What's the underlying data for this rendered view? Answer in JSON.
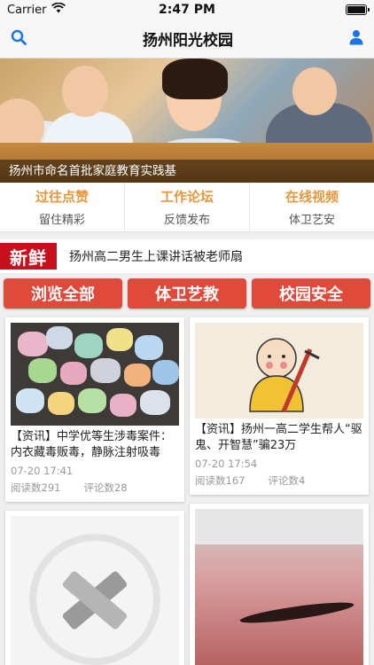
{
  "status_bar": {
    "carrier": "Carrier",
    "time": "2:47 PM",
    "battery_level": 1.0
  },
  "navbar": {
    "title": "扬州阳光校园"
  },
  "banner": {
    "caption": "扬州市命名首批家庭教育实践基"
  },
  "quick_tabs": [
    {
      "main": "过往点赞",
      "sub": "留住精彩"
    },
    {
      "main": "工作论坛",
      "sub": "反馈发布"
    },
    {
      "main": "在线视频",
      "sub": "体卫艺安"
    }
  ],
  "ticker": {
    "logo_text": "新鲜",
    "headline": "扬州高二男生上课讲话被老师扇"
  },
  "categories": [
    "浏览全部",
    "体卫艺教",
    "校园安全"
  ],
  "cards": [
    {
      "title": "【资讯】中学优等生涉毒案件：内衣藏毒贩毒，静脉注射吸毒",
      "date": "07-20 17:41",
      "reads": "阅读数291",
      "comments": "评论数28"
    },
    {
      "title": "【资讯】扬州一高二学生帮人“驱鬼、开智慧”骗23万",
      "date": "07-20 17:54",
      "reads": "阅读数167",
      "comments": "评论数4"
    }
  ],
  "colors": {
    "accent_orange": "#e8963a",
    "category_red": "#e04a3a",
    "icon_blue": "#1a73e8"
  }
}
